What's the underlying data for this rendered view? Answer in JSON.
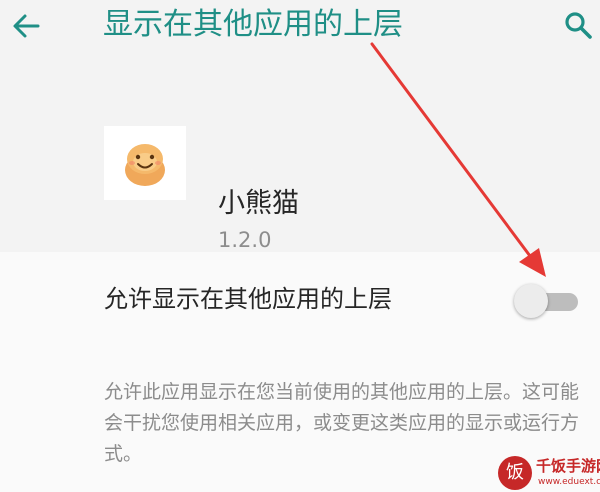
{
  "header": {
    "title": "显示在其他应用的上层",
    "back_icon": "arrow-left-icon",
    "search_icon": "search-icon"
  },
  "app": {
    "name": "小熊猫",
    "version": "1.2.0",
    "icon": "smiley-face-icon"
  },
  "permission": {
    "label": "允许显示在其他应用的上层",
    "enabled": false,
    "description": "允许此应用显示在您当前使用的其他应用的上层。这可能会干扰您使用相关应用，或变更这类应用的显示或运行方式。"
  },
  "watermark": {
    "logo_char": "饭",
    "name": "千饭手游网",
    "url": "www.eduext.com"
  },
  "colors": {
    "accent": "#1f8f86",
    "annotation_arrow": "#e53935"
  }
}
